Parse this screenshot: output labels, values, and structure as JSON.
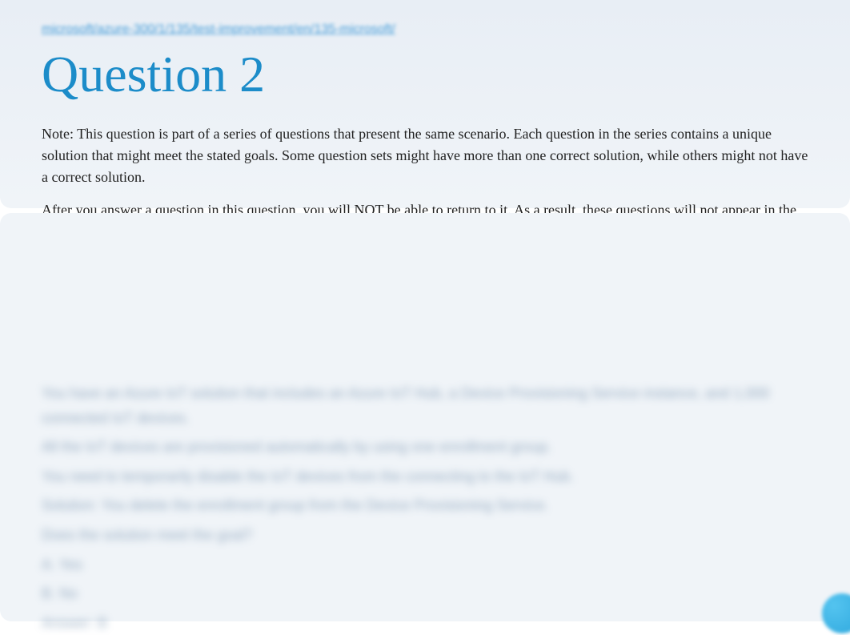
{
  "top_link": "microsoft/azure-300/1/135/test-improvement/en/135-microsoft/",
  "title": "Question 2",
  "note_paragraph_1": "Note: This question is part of a series of questions that present the same scenario. Each question in the series contains a unique solution that might meet the stated goals. Some question sets might have more than one correct solution, while others might not have a correct solution.",
  "note_paragraph_2": "After you answer a question in this question, you will NOT be able to return to it. As a result, these questions will not appear in the review screen.",
  "blurred": {
    "line1": "You have an Azure IoT solution that includes an Azure IoT Hub, a Device Provisioning Service instance, and 1,000 connected IoT devices.",
    "line2": "All the IoT devices are provisioned automatically by using one enrollment group.",
    "line3": "You need to temporarily disable the IoT devices from the connecting to the IoT Hub.",
    "line4": "Solution: You delete the enrollment group from the Device Provisioning Service.",
    "line5": "Does the solution meet the goal?",
    "opt_a": "A. Yes",
    "opt_b": "B. No",
    "answer": "Answer: B"
  }
}
